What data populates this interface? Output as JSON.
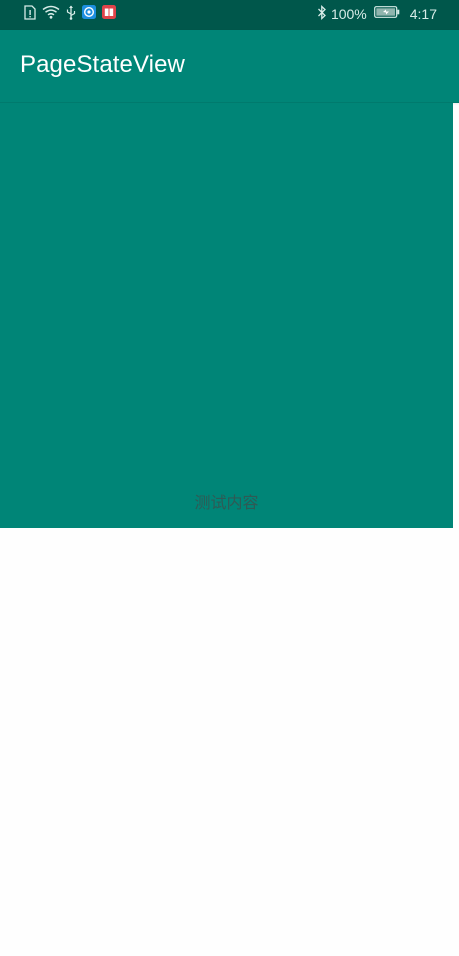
{
  "status_bar": {
    "battery_percent": "100%",
    "time": "4:17",
    "left_icons": [
      "sim-alert-icon",
      "wifi-icon",
      "usb-icon",
      "browser-app-icon",
      "book-app-icon"
    ],
    "right_icons": [
      "bluetooth-icon",
      "battery-icon"
    ]
  },
  "toolbar": {
    "title": "PageStateView"
  },
  "content": {
    "text": "测试内容"
  },
  "colors": {
    "status_bar": "#00574b",
    "primary": "#008577",
    "background": "#fefefe",
    "title_text": "#ffffff",
    "content_text": "#2f5a55"
  }
}
